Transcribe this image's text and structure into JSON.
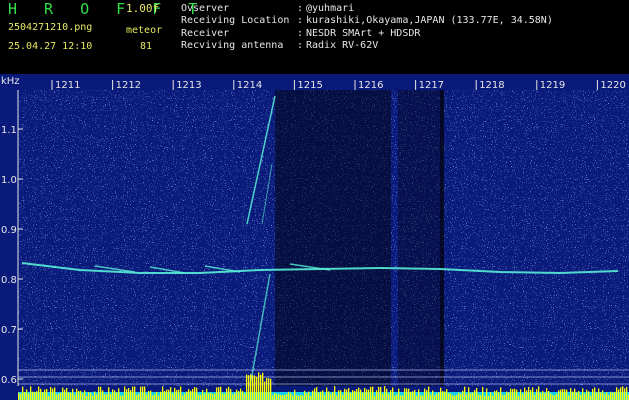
{
  "header": {
    "title": "H R O F F T",
    "version": "1.00f",
    "filename": "2504271210.png",
    "type": "meteor",
    "datetime": "25.04.27 12:10",
    "count": "81"
  },
  "info": [
    {
      "label": "Ovserver",
      "value": "@yuhmari"
    },
    {
      "label": "Receiving Location",
      "value": "kurashiki,Okayama,JAPAN (133.77E, 34.58N)"
    },
    {
      "label": "Receiver",
      "value": "NESDR SMArt + HDSDR"
    },
    {
      "label": "Recviving antenna",
      "value": "Radix RV-62V"
    }
  ],
  "axis": {
    "unit": "kHz",
    "y_ticks": [
      "1.1",
      "1.0",
      "0.9",
      "0.8",
      "0.7",
      "0.6"
    ],
    "x_ticks": [
      "1211",
      "1212",
      "1213",
      "1214",
      "1215",
      "1216",
      "1217",
      "1218",
      "1219",
      "1220"
    ]
  },
  "colors": {
    "background": "#0a1a7a",
    "noise": "#3f78ff",
    "echo": "#58f0d8",
    "bar": "#ffff00",
    "bar_low": "#16d0f0",
    "text": "#e6e6e6",
    "title": "#33e04a",
    "label": "#e8e864"
  }
}
